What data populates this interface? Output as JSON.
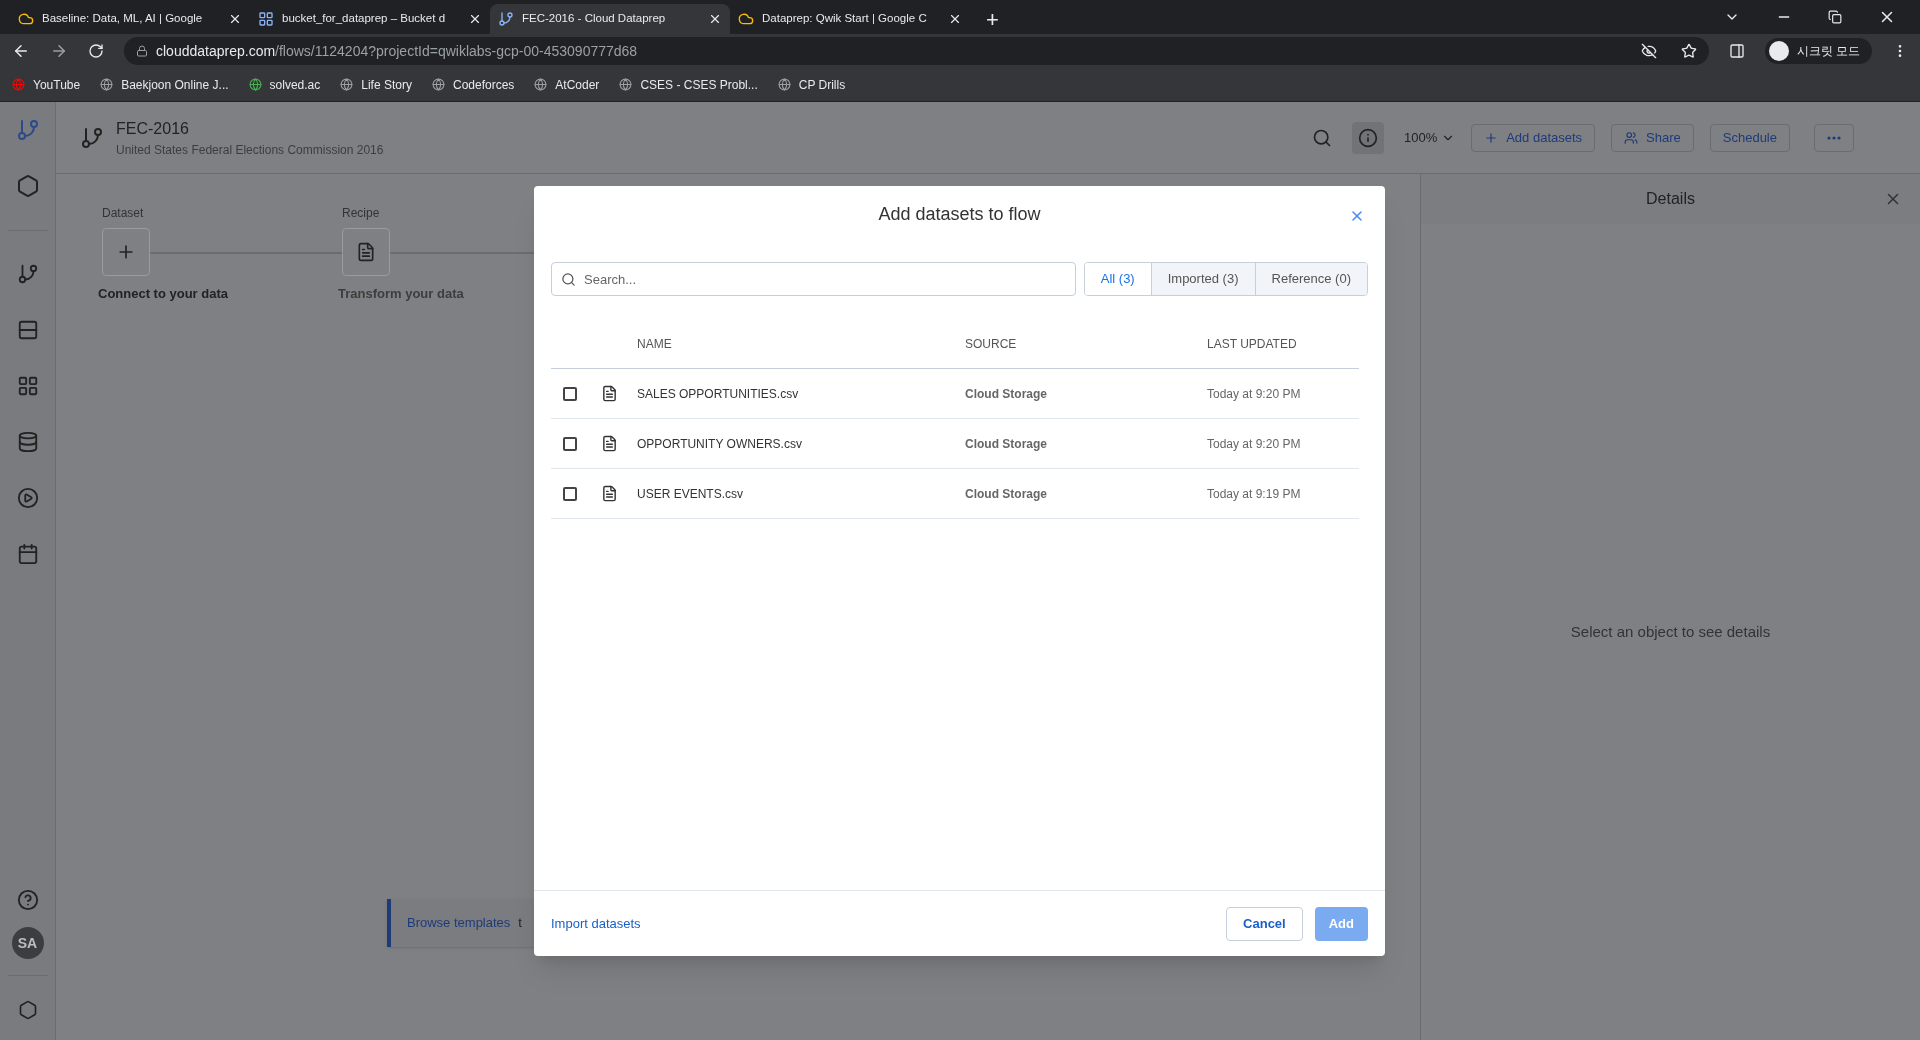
{
  "browser": {
    "tabs": [
      {
        "title": "Baseline: Data, ML, AI | Google",
        "selected": false
      },
      {
        "title": "bucket_for_dataprep – Bucket d",
        "selected": false
      },
      {
        "title": "FEC-2016 - Cloud Dataprep",
        "selected": true
      },
      {
        "title": "Dataprep: Qwik Start | Google C",
        "selected": false
      }
    ],
    "new_tab": "+",
    "address": {
      "domain": "clouddataprep.com",
      "path": "/flows/1124204?projectId=qwiklabs-gcp-00-453090777d68"
    },
    "profile": "시크릿 모드",
    "bookmarks": [
      "YouTube",
      "Baekjoon Online J...",
      "solved.ac",
      "Life Story",
      "Codeforces",
      "AtCoder",
      "CSES - CSES Probl...",
      "CP Drills"
    ]
  },
  "app": {
    "flow_title": "FEC-2016",
    "flow_subtitle": "United States Federal Elections Commission 2016",
    "toolbar": {
      "zoom": "100%",
      "buttons": [
        "Add datasets",
        "Share",
        "Schedule"
      ]
    },
    "avatar": "SA",
    "canvas": {
      "nodes": [
        {
          "kind": "dataset",
          "label": "Dataset",
          "caption": "Connect to your data"
        },
        {
          "kind": "recipe",
          "label": "Recipe",
          "caption": "Transform your data"
        }
      ],
      "toast": {
        "link": "Browse templates",
        "text": "t"
      }
    },
    "details": {
      "title": "Details",
      "empty": "Select an object to see details"
    }
  },
  "dialog": {
    "title": "Add datasets to flow",
    "search": {
      "placeholder": "Search..."
    },
    "filters": [
      {
        "label": "All (3)",
        "selected": true
      },
      {
        "label": "Imported (3)",
        "selected": false
      },
      {
        "label": "Reference (0)",
        "selected": false
      }
    ],
    "table": {
      "columns": [
        "NAME",
        "SOURCE",
        "LAST UPDATED"
      ],
      "rows": [
        {
          "checked": false,
          "name": "SALES OPPORTUNITIES.csv",
          "source": "Cloud Storage",
          "updated": "Today at 9:20 PM"
        },
        {
          "checked": false,
          "name": "OPPORTUNITY OWNERS.csv",
          "source": "Cloud Storage",
          "updated": "Today at 9:20 PM"
        },
        {
          "checked": false,
          "name": "USER EVENTS.csv",
          "source": "Cloud Storage",
          "updated": "Today at 9:19 PM"
        }
      ]
    },
    "import_link": "Import datasets",
    "cancel": "Cancel",
    "add": {
      "label": "Add",
      "disabled": true
    }
  }
}
